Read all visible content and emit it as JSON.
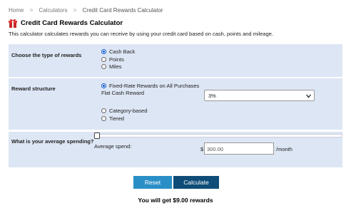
{
  "breadcrumb": {
    "items": [
      "Home",
      "Calculators",
      "Credit Card Rewards Calculator"
    ],
    "separator": ">"
  },
  "page": {
    "title": "Credit Card Rewards Calculator",
    "description": "This calculator calculates rewards you can receive by using your credit card based on cash, points and mileage."
  },
  "reward_type": {
    "label": "Choose the type of rewards",
    "options": [
      "Cash Back",
      "Points",
      "Miles"
    ],
    "selected": "Cash Back"
  },
  "reward_structure": {
    "label": "Reward structure",
    "options": [
      "Fixed-Rate Rewards on All Purchases",
      "Category-based",
      "Tiered"
    ],
    "selected": "Fixed-Rate Rewards on All Purchases",
    "flat_label": "Flat Cash Reward",
    "flat_value": "3%"
  },
  "spending": {
    "label": "What is your average spending?",
    "sublabel": "Average spend:",
    "currency": "$",
    "value": "300.00",
    "unit": "/month",
    "slider_level": 0
  },
  "buttons": {
    "reset": "Reset",
    "calculate": "Calculate"
  },
  "result": {
    "text": "You will get $9.00 rewards"
  },
  "colors": {
    "panel_bg": "#dde6f4",
    "reset_btn": "#2b8fc7",
    "calculate_btn": "#0f4d78",
    "radio_accent": "#0b57d0",
    "gift_red": "#c62828"
  },
  "icons": {
    "title": "gift-icon",
    "select": "chevron-down-icon"
  }
}
